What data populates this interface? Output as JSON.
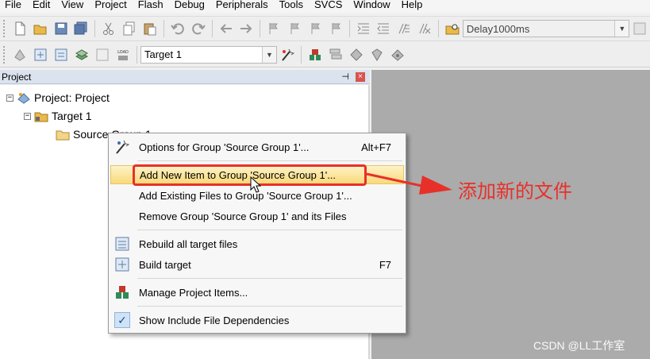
{
  "menubar": {
    "items": [
      "File",
      "Edit",
      "View",
      "Project",
      "Flash",
      "Debug",
      "Peripherals",
      "Tools",
      "SVCS",
      "Window",
      "Help"
    ]
  },
  "toolbar1": {
    "function_combo": "Delay1000ms"
  },
  "toolbar2": {
    "target_combo": "Target 1",
    "load_label": "LOAD"
  },
  "panel": {
    "title": "Project",
    "pin_glyph": "⊣",
    "close_glyph": "×"
  },
  "tree": {
    "project": "Project: Project",
    "target": "Target 1",
    "group": "Source Group 1"
  },
  "context_menu": {
    "options_for_group": {
      "label": "Options for Group 'Source Group 1'...",
      "shortcut": "Alt+F7"
    },
    "add_new_item": {
      "label": "Add New  Item to Group 'Source Group 1'..."
    },
    "add_existing": {
      "label": "Add Existing Files to Group 'Source Group 1'..."
    },
    "remove_group": {
      "label": "Remove Group 'Source Group 1' and its Files"
    },
    "rebuild_all": {
      "label": "Rebuild all target files"
    },
    "build_target": {
      "label": "Build target",
      "shortcut": "F7"
    },
    "manage_items": {
      "label": "Manage Project Items..."
    },
    "show_include": {
      "label": "Show Include File Dependencies",
      "checked": true
    }
  },
  "annotation": {
    "text": "添加新的文件",
    "color": "#e8302a"
  },
  "watermark": "CSDN @LL工作室",
  "colors": {
    "highlight": "#f9d97a",
    "panel_header": "#dae3ee",
    "editor_area": "#ababab"
  }
}
